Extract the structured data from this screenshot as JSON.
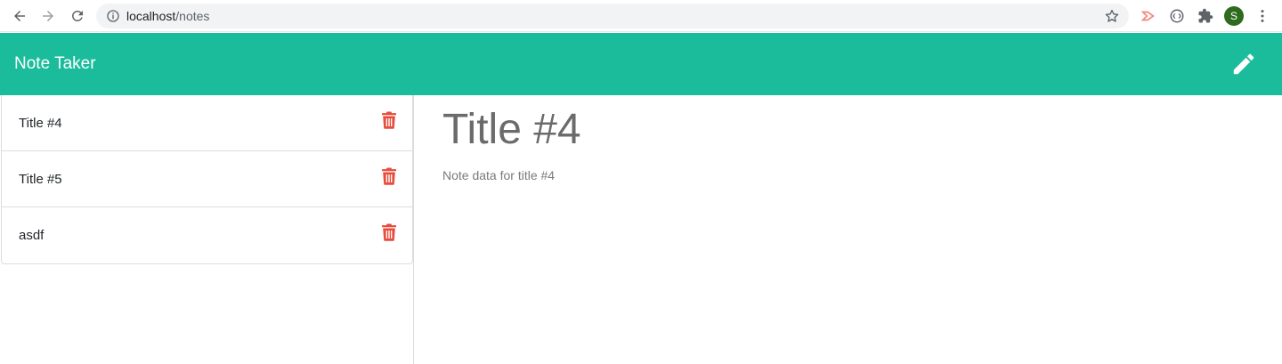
{
  "browser": {
    "url_host": "localhost",
    "url_path": "/notes",
    "profile_initial": "S",
    "icons": [
      "back-arrow-icon",
      "forward-arrow-icon",
      "reload-icon",
      "info-icon",
      "bookmark-star-icon",
      "extension-red-icon",
      "extension-circle-icon",
      "extensions-puzzle-icon",
      "more-menu-icon"
    ]
  },
  "header": {
    "brand": "Note Taker",
    "new_note_icon": "pencil-icon"
  },
  "sidebar": {
    "notes": [
      {
        "title": "Title #4",
        "delete_icon": "trash-icon"
      },
      {
        "title": "Title #5",
        "delete_icon": "trash-icon"
      },
      {
        "title": "asdf",
        "delete_icon": "trash-icon"
      }
    ]
  },
  "note": {
    "title": "Title #4",
    "text": "Note data for title #4"
  },
  "colors": {
    "header_bg": "#1abc9c",
    "delete_red": "#e74c3c",
    "heading_gray": "#6b6b6b"
  }
}
